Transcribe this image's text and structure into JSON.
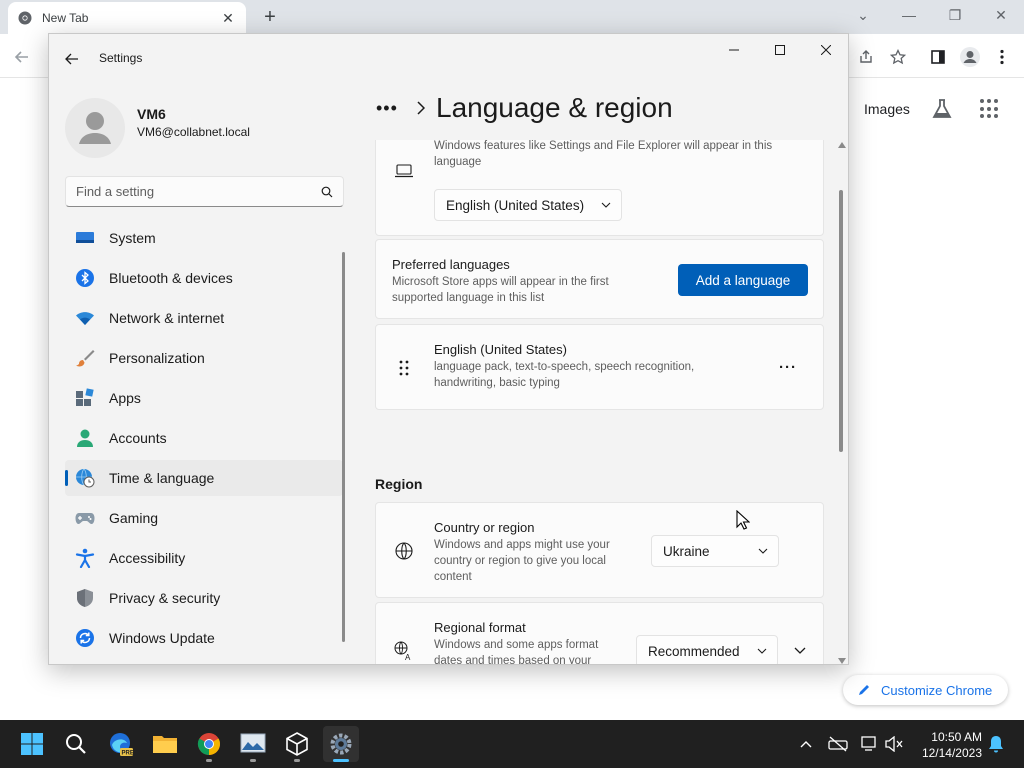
{
  "chrome": {
    "tab_title": "New Tab",
    "images_link": "Images",
    "customize_label": "Customize Chrome"
  },
  "settings": {
    "window_title": "Settings",
    "user": {
      "name": "VM6",
      "email": "VM6@collabnet.local"
    },
    "search": {
      "placeholder": "Find a setting"
    },
    "nav": [
      {
        "label": "System",
        "icon": "system-icon"
      },
      {
        "label": "Bluetooth & devices",
        "icon": "bluetooth-icon"
      },
      {
        "label": "Network & internet",
        "icon": "wifi-icon"
      },
      {
        "label": "Personalization",
        "icon": "brush-icon"
      },
      {
        "label": "Apps",
        "icon": "apps-icon"
      },
      {
        "label": "Accounts",
        "icon": "accounts-icon"
      },
      {
        "label": "Time & language",
        "icon": "globe-clock-icon",
        "active": true
      },
      {
        "label": "Gaming",
        "icon": "gamepad-icon"
      },
      {
        "label": "Accessibility",
        "icon": "accessibility-icon"
      },
      {
        "label": "Privacy & security",
        "icon": "shield-icon"
      },
      {
        "label": "Windows Update",
        "icon": "update-icon"
      }
    ],
    "breadcrumb": {
      "more": "•••",
      "title": "Language & region"
    },
    "display_language": {
      "description": "Windows features like Settings and File Explorer will appear in this language",
      "value": "English (United States)"
    },
    "preferred_languages": {
      "title": "Preferred languages",
      "description": "Microsoft Store apps will appear in the first supported language in this list",
      "button": "Add a language"
    },
    "language_entry": {
      "title": "English (United States)",
      "description": "language pack, text-to-speech, speech recognition, handwriting, basic typing",
      "more": "···"
    },
    "region": {
      "header": "Region",
      "country": {
        "title": "Country or region",
        "description": "Windows and apps might use your country or region to give you local content",
        "value": "Ukraine"
      },
      "format": {
        "title": "Regional format",
        "description": "Windows and some apps format dates and times based on your regional format",
        "value": "Recommended"
      }
    }
  },
  "taskbar": {
    "time": "10:50 AM",
    "date": "12/14/2023"
  },
  "colors": {
    "accent": "#005fb8",
    "taskbar": "#202020",
    "settings_bg": "#f3f3f3",
    "card_bg": "#fbfbfb"
  }
}
